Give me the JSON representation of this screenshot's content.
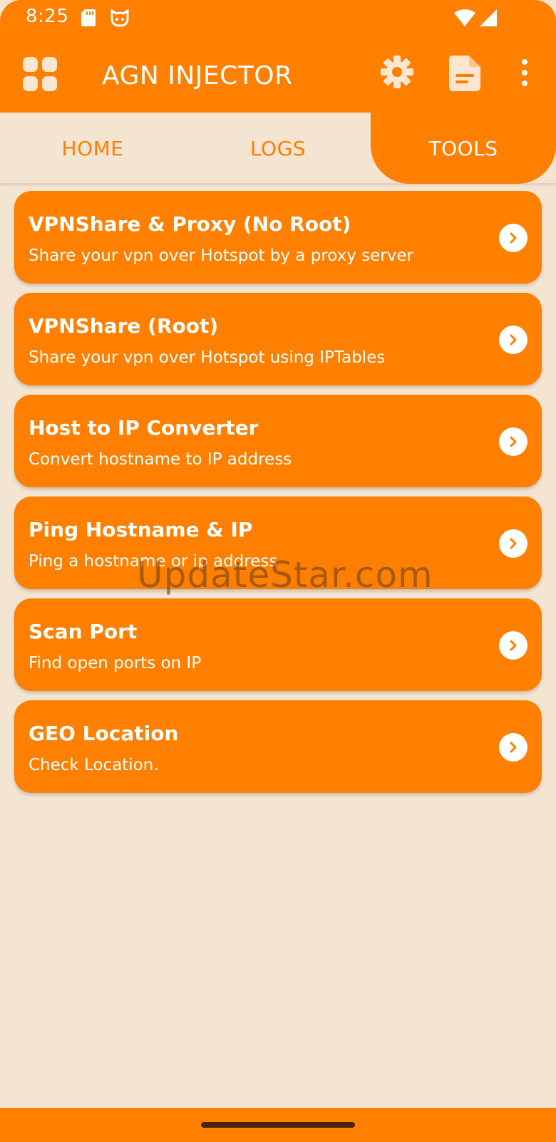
{
  "status_bar": {
    "time": "8:25",
    "icons": [
      "sd-card-icon",
      "cat-icon",
      "wifi-icon",
      "signal-icon"
    ]
  },
  "app_bar": {
    "title": "AGN INJECTOR",
    "icons": [
      "apps-grid-icon",
      "gear-icon",
      "document-icon",
      "more-vert-icon"
    ]
  },
  "tabs": [
    {
      "label": "HOME",
      "active": false
    },
    {
      "label": "LOGS",
      "active": false
    },
    {
      "label": "TOOLS",
      "active": true
    }
  ],
  "tools": [
    {
      "title": "VPNShare & Proxy (No Root)",
      "subtitle": "Share your vpn over Hotspot by a proxy server"
    },
    {
      "title": "VPNShare (Root)",
      "subtitle": "Share your vpn over Hotspot using IPTables"
    },
    {
      "title": "Host to IP Converter",
      "subtitle": "Convert hostname to IP address"
    },
    {
      "title": "Ping Hostname & IP",
      "subtitle": "Ping a hostname or ip address"
    },
    {
      "title": "Scan Port",
      "subtitle": "Find open ports on IP"
    },
    {
      "title": "GEO Location",
      "subtitle": "Check Location."
    }
  ],
  "watermark": "UpdateStar.com",
  "colors": {
    "accent": "#ff7f00",
    "background": "#f4e4d2",
    "on_accent": "#ffffff"
  }
}
